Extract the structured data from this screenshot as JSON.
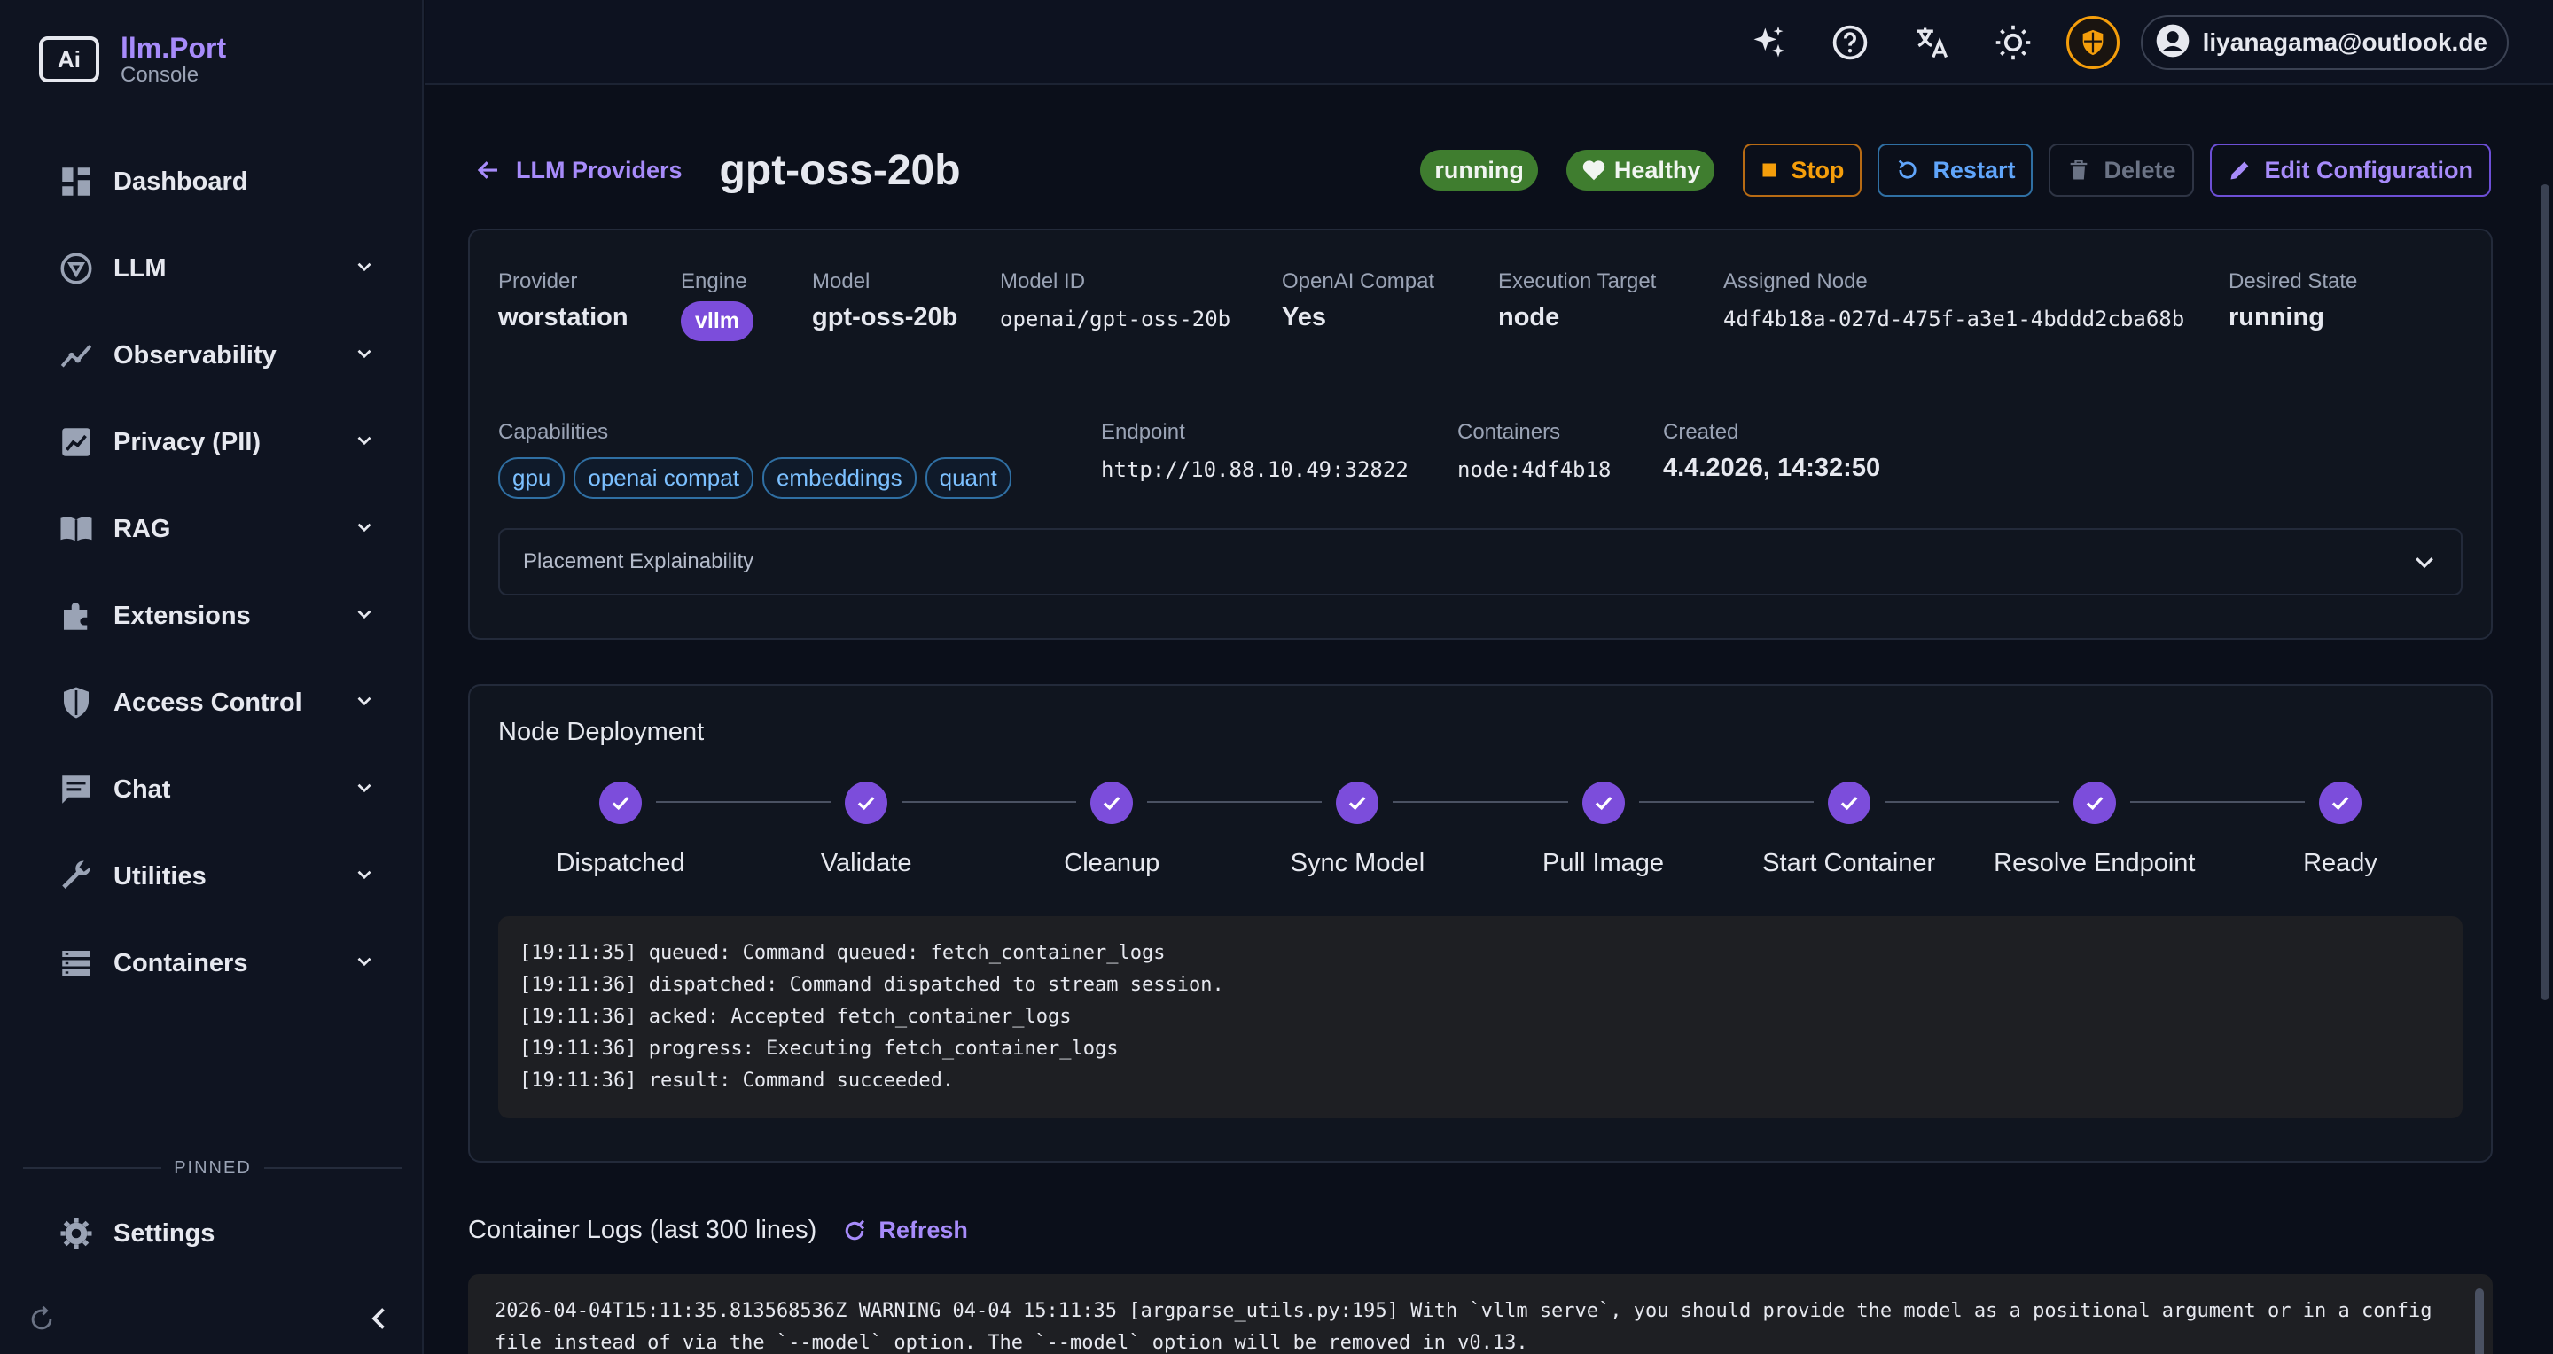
{
  "brand": {
    "name": "llm.Port",
    "subtitle": "Console",
    "logo_text": "Ai"
  },
  "sidebar": {
    "items": [
      {
        "label": "Dashboard",
        "icon": "dashboard-icon",
        "expandable": false
      },
      {
        "label": "LLM",
        "icon": "llm-icon",
        "expandable": true
      },
      {
        "label": "Observability",
        "icon": "observability-icon",
        "expandable": true
      },
      {
        "label": "Privacy (PII)",
        "icon": "privacy-icon",
        "expandable": true
      },
      {
        "label": "RAG",
        "icon": "rag-book-icon",
        "expandable": true
      },
      {
        "label": "Extensions",
        "icon": "puzzle-icon",
        "expandable": true
      },
      {
        "label": "Access Control",
        "icon": "shield-icon",
        "expandable": true
      },
      {
        "label": "Chat",
        "icon": "chat-icon",
        "expandable": true
      },
      {
        "label": "Utilities",
        "icon": "wrench-icon",
        "expandable": true
      },
      {
        "label": "Containers",
        "icon": "containers-icon",
        "expandable": true
      }
    ],
    "pinned_label": "PINNED",
    "settings_label": "Settings"
  },
  "topbar": {
    "user_email": "liyanagama@outlook.de"
  },
  "header": {
    "back_label": "LLM Providers",
    "title": "gpt-oss-20b",
    "status_pill": "running",
    "health_pill": "Healthy",
    "stop_label": "Stop",
    "restart_label": "Restart",
    "delete_label": "Delete",
    "edit_label": "Edit Configuration"
  },
  "info": {
    "provider": {
      "label": "Provider",
      "value": "worstation"
    },
    "engine": {
      "label": "Engine",
      "value": "vllm"
    },
    "model": {
      "label": "Model",
      "value": "gpt-oss-20b"
    },
    "model_id": {
      "label": "Model ID",
      "value": "openai/gpt-oss-20b"
    },
    "openai_compat": {
      "label": "OpenAI Compat",
      "value": "Yes"
    },
    "execution_target": {
      "label": "Execution Target",
      "value": "node"
    },
    "assigned_node": {
      "label": "Assigned Node",
      "value": "4df4b18a-027d-475f-a3e1-4bddd2cba68b"
    },
    "desired_state": {
      "label": "Desired State",
      "value": "running"
    },
    "capabilities": {
      "label": "Capabilities",
      "chips": [
        "gpu",
        "openai compat",
        "embeddings",
        "quant"
      ]
    },
    "endpoint": {
      "label": "Endpoint",
      "value": "http://10.88.10.49:32822"
    },
    "containers": {
      "label": "Containers",
      "value": "node:4df4b18"
    },
    "created": {
      "label": "Created",
      "value": "4.4.2026, 14:32:50"
    },
    "placement_label": "Placement Explainability"
  },
  "deployment": {
    "title": "Node Deployment",
    "steps": [
      "Dispatched",
      "Validate",
      "Cleanup",
      "Sync Model",
      "Pull Image",
      "Start Container",
      "Resolve Endpoint",
      "Ready"
    ],
    "logs": [
      "[19:11:35] queued: Command queued: fetch_container_logs",
      "[19:11:36] dispatched: Command dispatched to stream session.",
      "[19:11:36] acked: Accepted fetch_container_logs",
      "[19:11:36] progress: Executing fetch_container_logs",
      "[19:11:36] result: Command succeeded."
    ]
  },
  "container_logs": {
    "title": "Container Logs (last 300 lines)",
    "refresh_label": "Refresh",
    "lines": [
      "2026-04-04T15:11:35.813568536Z WARNING 04-04 15:11:35 [argparse_utils.py:195] With `vllm serve`, you should provide the model as a positional argument or in a config",
      "file instead of via the `--model` option. The `--model` option will be removed in v0.13."
    ]
  },
  "colors": {
    "accent": "#a78bfa",
    "step_done": "#7c4ddb",
    "running": "#3f7d2f",
    "stop": "#f59e0b",
    "restart": "#60a5fa"
  }
}
